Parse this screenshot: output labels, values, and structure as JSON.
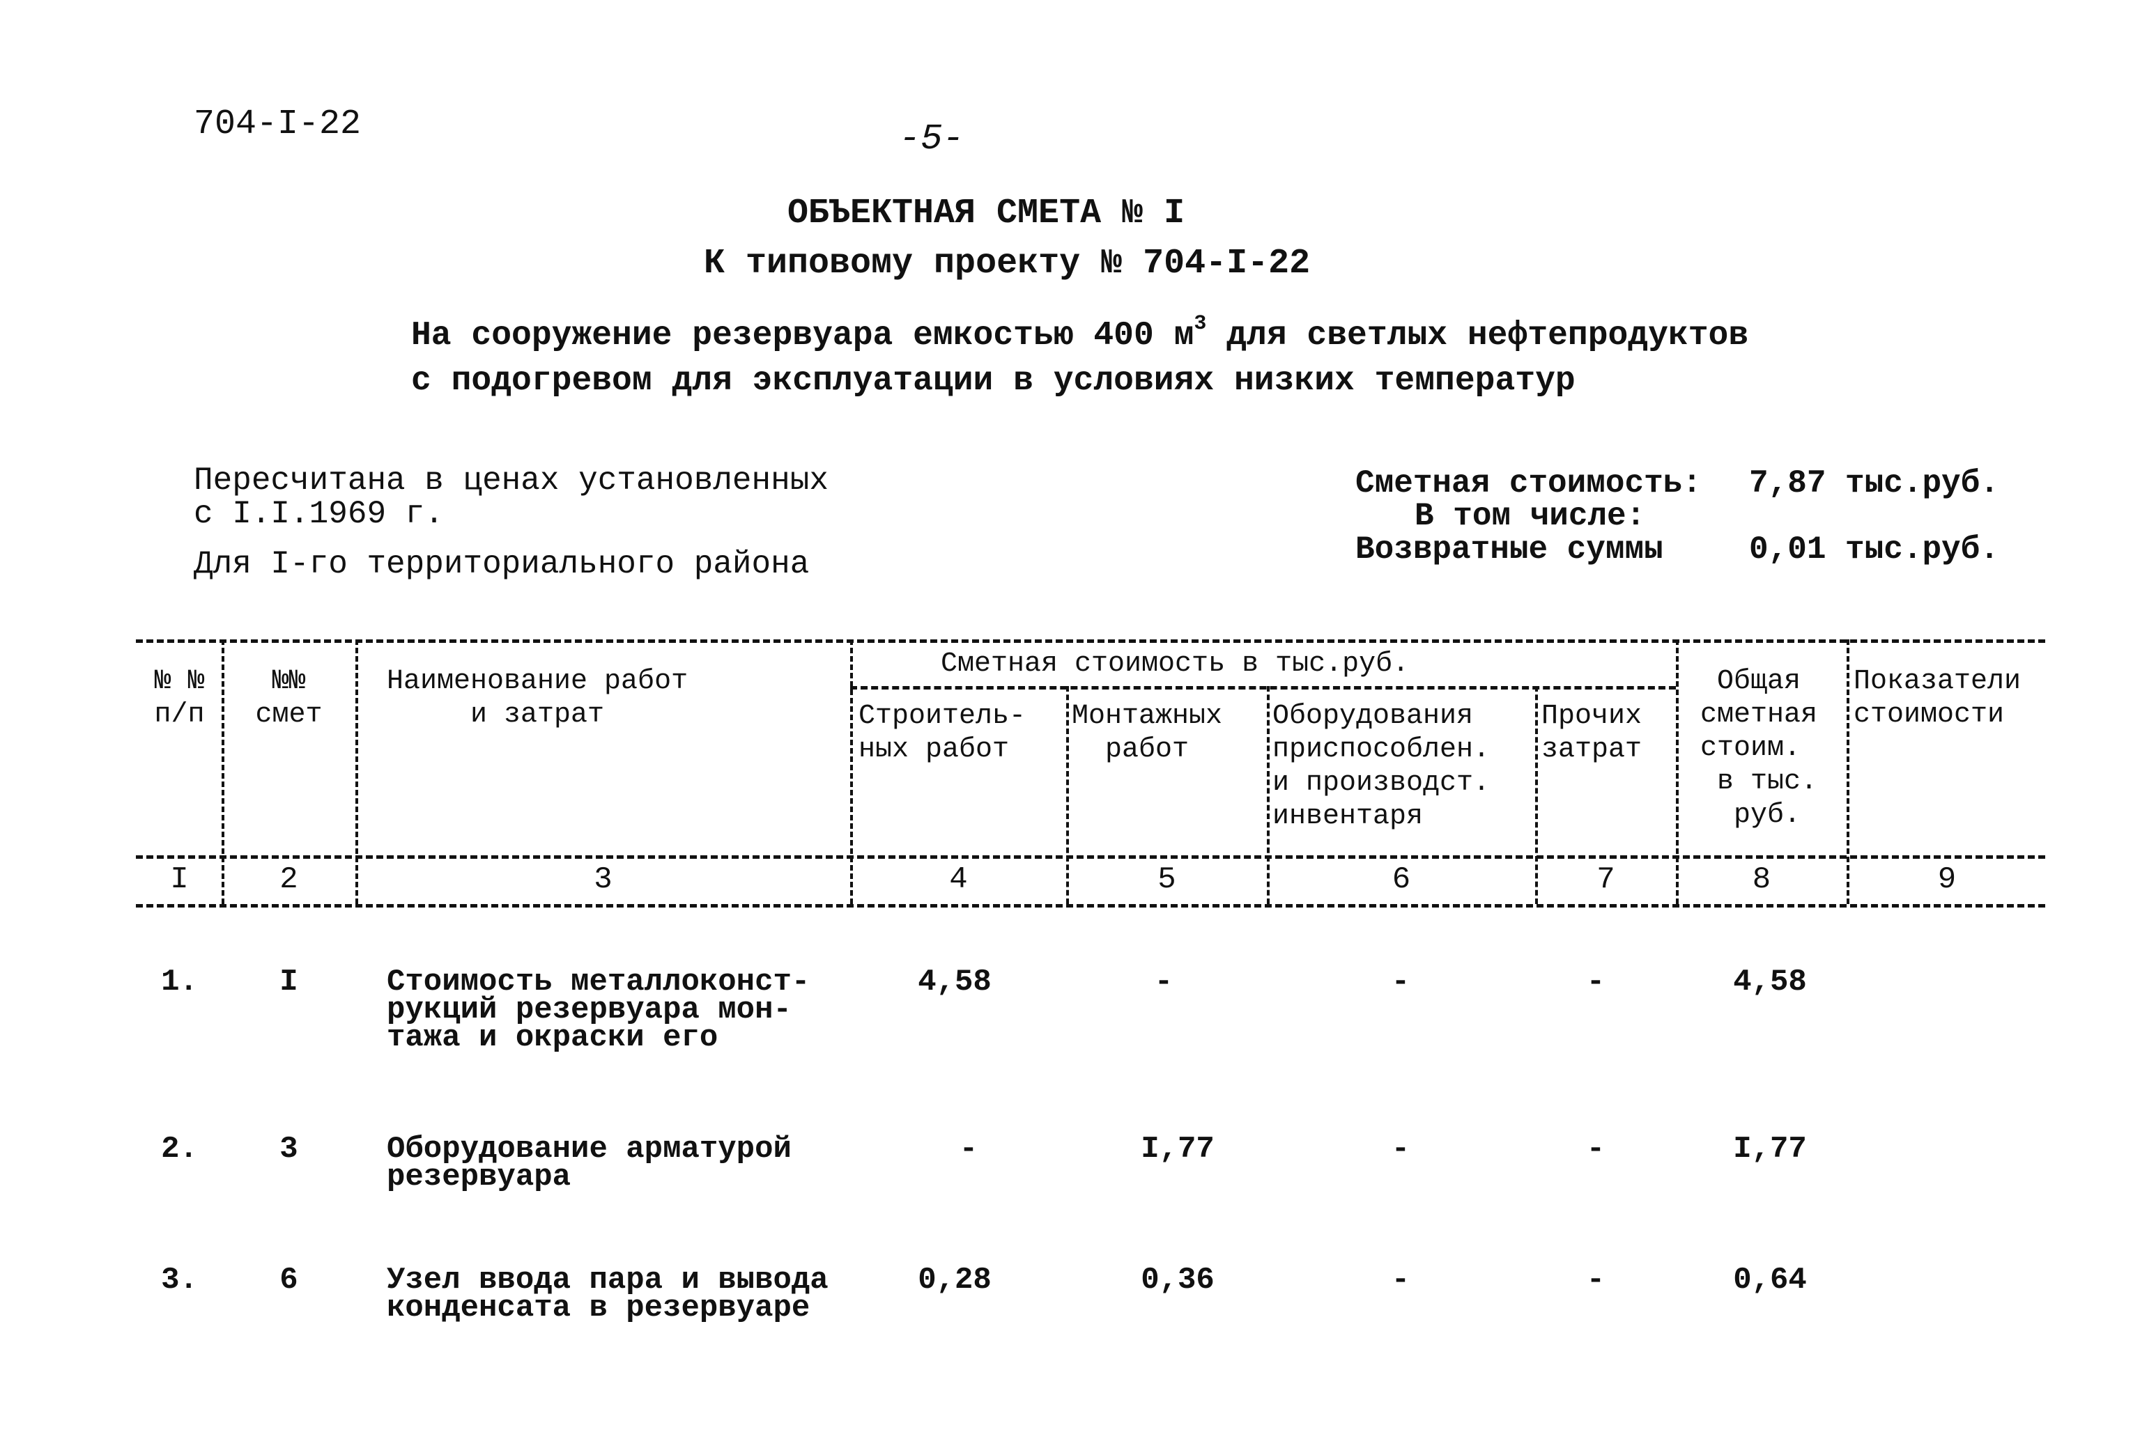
{
  "header": {
    "doc_code": "704-I-22",
    "page_number": "-5-",
    "title": "ОБЪЕКТНАЯ СМЕТА № I",
    "subtitle": "К типовому проекту № 704-I-22",
    "description_line1_pre": "На сооружение резервуара емкостью 400 м",
    "description_line1_sup": "3",
    "description_line1_post": " для светлых нефтепродуктов",
    "description_line2": "с подогревом для эксплуатации в условиях низких температур"
  },
  "info": {
    "recalc_line1": "Пересчитана в ценах установленных",
    "recalc_line2": "с I.I.1969 г.",
    "region": "Для I-го территориального района",
    "estimated_cost_label": "Сметная стоимость:",
    "estimated_cost_value": "7,87 тыс.руб.",
    "including_label": "В том числе:",
    "returnable_label": "Возвратные суммы",
    "returnable_value": "0,01 тыс.руб."
  },
  "table": {
    "headers": {
      "col1": "№ №\nп/п",
      "col2": "№№\nсмет",
      "col3": "Наименование работ\n     и затрат",
      "group": "Сметная стоимость в тыс.руб.",
      "col4": "Строитель-\nных работ",
      "col5": "Монтажных\n  работ",
      "col6": "Оборудования\nприспособлен.\nи производст.\nинвентаря",
      "col7": "Прочих\nзатрат",
      "col8": " Общая\nсметная\nстоим.\n в тыс.\n  руб.",
      "col9": "Показатели\nстоимости"
    },
    "column_numbers": [
      "I",
      "2",
      "3",
      "4",
      "5",
      "6",
      "7",
      "8",
      "9"
    ],
    "rows": [
      {
        "num": "1.",
        "estimate": "I",
        "name": "Стоимость металлоконст-\nрукций резервуара мон-\nтажа и окраски его",
        "construction": "4,58",
        "installation": "-",
        "equipment": "-",
        "other": "-",
        "total": "4,58",
        "indicators": ""
      },
      {
        "num": "2.",
        "estimate": "3",
        "name": "Оборудование арматурой\nрезервуара",
        "construction": "-",
        "installation": "I,77",
        "equipment": "-",
        "other": "-",
        "total": "I,77",
        "indicators": ""
      },
      {
        "num": "3.",
        "estimate": "6",
        "name": "Узел ввода пара и вывода\nконденсата в резервуаре",
        "construction": "0,28",
        "installation": "0,36",
        "equipment": "-",
        "other": "-",
        "total": "0,64",
        "indicators": ""
      }
    ]
  }
}
